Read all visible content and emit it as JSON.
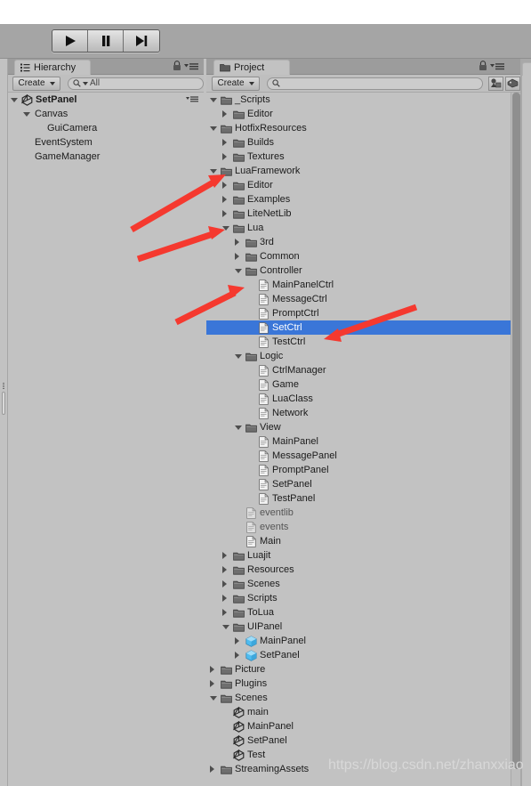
{
  "toolbar": {
    "buttons": [
      {
        "name": "play-button",
        "icon": "play-icon"
      },
      {
        "name": "pause-button",
        "icon": "pause-icon"
      },
      {
        "name": "step-button",
        "icon": "step-icon"
      }
    ]
  },
  "hierarchy": {
    "tab_label": "Hierarchy",
    "tab_icon": "hierarchy-icon",
    "create_label": "Create",
    "search_placeholder": "All",
    "search_value": "All",
    "lock_icon": "lock-icon",
    "menu_icon": "menu-icon",
    "rows": [
      {
        "label": "SetPanel",
        "depth": 0,
        "toggle": "down",
        "icon": "unity-scene-icon",
        "bold": true
      },
      {
        "label": "Canvas",
        "depth": 1,
        "toggle": "down",
        "icon": "none",
        "bold": false
      },
      {
        "label": "GuiCamera",
        "depth": 2,
        "toggle": "none",
        "icon": "none",
        "bold": false
      },
      {
        "label": "EventSystem",
        "depth": 1,
        "toggle": "none",
        "icon": "none",
        "bold": false
      },
      {
        "label": "GameManager",
        "depth": 1,
        "toggle": "none",
        "icon": "none",
        "bold": false
      }
    ]
  },
  "project": {
    "tab_label": "Project",
    "tab_icon": "folder-icon",
    "create_label": "Create",
    "search_placeholder": "",
    "search_value": "",
    "lock_icon": "lock-icon",
    "menu_icon": "menu-icon",
    "filter_icons": [
      {
        "name": "filter-by-type-icon"
      },
      {
        "name": "filter-by-label-icon"
      }
    ],
    "selected_row": "SetCtrl",
    "selection_color": "#3a76d8",
    "rows": [
      {
        "label": "_Scripts",
        "depth": 0,
        "toggle": "down",
        "icon": "folder-icon"
      },
      {
        "label": "Editor",
        "depth": 1,
        "toggle": "right",
        "icon": "folder-icon"
      },
      {
        "label": "HotfixResources",
        "depth": 0,
        "toggle": "down",
        "icon": "folder-icon"
      },
      {
        "label": "Builds",
        "depth": 1,
        "toggle": "right",
        "icon": "folder-icon"
      },
      {
        "label": "Textures",
        "depth": 1,
        "toggle": "right",
        "icon": "folder-icon"
      },
      {
        "label": "LuaFramework",
        "depth": 0,
        "toggle": "down",
        "icon": "folder-icon"
      },
      {
        "label": "Editor",
        "depth": 1,
        "toggle": "right",
        "icon": "folder-icon"
      },
      {
        "label": "Examples",
        "depth": 1,
        "toggle": "right",
        "icon": "folder-icon"
      },
      {
        "label": "LiteNetLib",
        "depth": 1,
        "toggle": "right",
        "icon": "folder-icon"
      },
      {
        "label": "Lua",
        "depth": 1,
        "toggle": "down",
        "icon": "folder-icon"
      },
      {
        "label": "3rd",
        "depth": 2,
        "toggle": "right",
        "icon": "folder-icon"
      },
      {
        "label": "Common",
        "depth": 2,
        "toggle": "right",
        "icon": "folder-icon"
      },
      {
        "label": "Controller",
        "depth": 2,
        "toggle": "down",
        "icon": "folder-icon"
      },
      {
        "label": "MainPanelCtrl",
        "depth": 3,
        "toggle": "none",
        "icon": "script-icon"
      },
      {
        "label": "MessageCtrl",
        "depth": 3,
        "toggle": "none",
        "icon": "script-icon"
      },
      {
        "label": "PromptCtrl",
        "depth": 3,
        "toggle": "none",
        "icon": "script-icon"
      },
      {
        "label": "SetCtrl",
        "depth": 3,
        "toggle": "none",
        "icon": "script-icon",
        "selected": true
      },
      {
        "label": "TestCtrl",
        "depth": 3,
        "toggle": "none",
        "icon": "script-icon"
      },
      {
        "label": "Logic",
        "depth": 2,
        "toggle": "down",
        "icon": "folder-icon"
      },
      {
        "label": "CtrlManager",
        "depth": 3,
        "toggle": "none",
        "icon": "script-icon"
      },
      {
        "label": "Game",
        "depth": 3,
        "toggle": "none",
        "icon": "script-icon"
      },
      {
        "label": "LuaClass",
        "depth": 3,
        "toggle": "none",
        "icon": "script-icon"
      },
      {
        "label": "Network",
        "depth": 3,
        "toggle": "none",
        "icon": "script-icon"
      },
      {
        "label": "View",
        "depth": 2,
        "toggle": "down",
        "icon": "folder-icon"
      },
      {
        "label": "MainPanel",
        "depth": 3,
        "toggle": "none",
        "icon": "script-icon"
      },
      {
        "label": "MessagePanel",
        "depth": 3,
        "toggle": "none",
        "icon": "script-icon"
      },
      {
        "label": "PromptPanel",
        "depth": 3,
        "toggle": "none",
        "icon": "script-icon"
      },
      {
        "label": "SetPanel",
        "depth": 3,
        "toggle": "none",
        "icon": "script-icon"
      },
      {
        "label": "TestPanel",
        "depth": 3,
        "toggle": "none",
        "icon": "script-icon"
      },
      {
        "label": "eventlib",
        "depth": 2,
        "toggle": "none",
        "icon": "script-icon-dim",
        "dim": true
      },
      {
        "label": "events",
        "depth": 2,
        "toggle": "none",
        "icon": "script-icon-dim",
        "dim": true
      },
      {
        "label": "Main",
        "depth": 2,
        "toggle": "none",
        "icon": "script-icon"
      },
      {
        "label": "Luajit",
        "depth": 1,
        "toggle": "right",
        "icon": "folder-icon"
      },
      {
        "label": "Resources",
        "depth": 1,
        "toggle": "right",
        "icon": "folder-icon"
      },
      {
        "label": "Scenes",
        "depth": 1,
        "toggle": "right",
        "icon": "folder-icon"
      },
      {
        "label": "Scripts",
        "depth": 1,
        "toggle": "right",
        "icon": "folder-icon"
      },
      {
        "label": "ToLua",
        "depth": 1,
        "toggle": "right",
        "icon": "folder-icon"
      },
      {
        "label": "UIPanel",
        "depth": 1,
        "toggle": "down",
        "icon": "folder-icon"
      },
      {
        "label": "MainPanel",
        "depth": 2,
        "toggle": "right",
        "icon": "prefab-icon"
      },
      {
        "label": "SetPanel",
        "depth": 2,
        "toggle": "right",
        "icon": "prefab-icon"
      },
      {
        "label": "Picture",
        "depth": 0,
        "toggle": "right",
        "icon": "folder-icon"
      },
      {
        "label": "Plugins",
        "depth": 0,
        "toggle": "right",
        "icon": "folder-icon"
      },
      {
        "label": "Scenes",
        "depth": 0,
        "toggle": "down",
        "icon": "folder-icon"
      },
      {
        "label": "main",
        "depth": 1,
        "toggle": "none",
        "icon": "unity-scene-icon"
      },
      {
        "label": "MainPanel",
        "depth": 1,
        "toggle": "none",
        "icon": "unity-scene-icon"
      },
      {
        "label": "SetPanel",
        "depth": 1,
        "toggle": "none",
        "icon": "unity-scene-icon"
      },
      {
        "label": "Test",
        "depth": 1,
        "toggle": "none",
        "icon": "unity-scene-icon"
      },
      {
        "label": "StreamingAssets",
        "depth": 0,
        "toggle": "right",
        "icon": "folder-icon"
      }
    ]
  },
  "annotations": {
    "arrow_color": "#f5392f",
    "arrows": [
      {
        "name": "arrow-to-lua-folder"
      },
      {
        "name": "arrow-to-controller-folder"
      },
      {
        "name": "arrow-to-controller-contents"
      },
      {
        "name": "arrow-to-setctrl"
      }
    ]
  },
  "watermark": {
    "text": "https://blog.csdn.net/zhanxxiao"
  }
}
